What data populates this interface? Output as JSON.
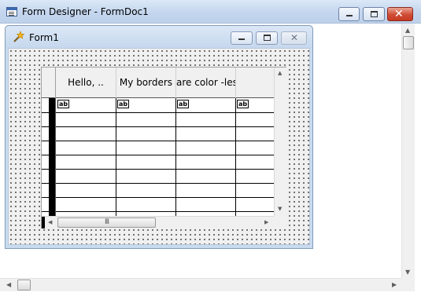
{
  "window": {
    "title": "Form Designer - FormDoc1",
    "icon": "form-designer-app-icon"
  },
  "form": {
    "title": "Form1",
    "icon": "form-wand-icon"
  },
  "grid": {
    "columns": [
      {
        "header": "Hello, .."
      },
      {
        "header": "My borders"
      },
      {
        "header": "are color -less"
      },
      {
        "header": ""
      }
    ],
    "cell_icon_text": "ab|",
    "visible_rows": 8,
    "hscroll_thumb_grip": "III"
  },
  "colors": {
    "close_button": "#c63a23",
    "titlebar": "#c4d6ee",
    "designer_background": "#f0f0f0"
  }
}
